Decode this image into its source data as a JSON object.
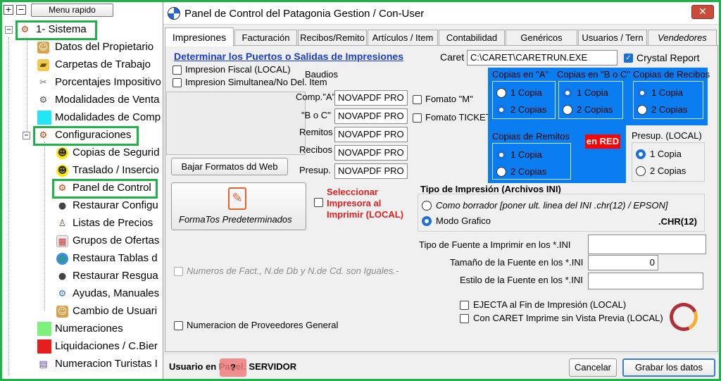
{
  "colors": {
    "highlight": "#1fb14a",
    "accent": "#0a7ef0",
    "red_badge": "#ff0000",
    "link": "#1a3ec8",
    "danger_text": "#e02020"
  },
  "tree": {
    "menu_rapido": "Menu rapido",
    "plus_btn": "+",
    "minus_btn": "−",
    "items": [
      {
        "label": "1- Sistema",
        "icon": "gear-icon"
      },
      {
        "label": "Datos del Propietario",
        "icon": "person-icon"
      },
      {
        "label": "Carpetas de Trabajo",
        "icon": "folder-icon"
      },
      {
        "label": "Porcentajes Impositivo",
        "icon": "tools-icon"
      },
      {
        "label": "Modalidades de Venta",
        "icon": "gear-icon"
      },
      {
        "label": "Modalidades de Comp",
        "icon": "cyan-square-icon"
      },
      {
        "label": "Configuraciones",
        "icon": "gear-icon"
      },
      {
        "label": "Copias de Segurid",
        "icon": "smiley-icon"
      },
      {
        "label": "Traslado / Insercio",
        "icon": "smiley-icon"
      },
      {
        "label": "Panel de Control",
        "icon": "gear-icon"
      },
      {
        "label": "Restaurar Configu",
        "icon": "traffic-light-icon"
      },
      {
        "label": "Listas de Precios",
        "icon": "person-icon"
      },
      {
        "label": "Grupos de Ofertas",
        "icon": "calendar-icon"
      },
      {
        "label": "Restaura Tablas d",
        "icon": "globe-icon"
      },
      {
        "label": "Restaurar Resgua",
        "icon": "traffic-light-icon"
      },
      {
        "label": "Ayudas, Manuales",
        "icon": "gear-icon"
      },
      {
        "label": "Cambio de Usuari",
        "icon": "person-icon"
      },
      {
        "label": "Numeraciones",
        "icon": "green-square-icon"
      },
      {
        "label": "Liquidaciones / C.Bier",
        "icon": "red-square-icon"
      },
      {
        "label": "Numeracion Turistas I",
        "icon": "book-icon"
      }
    ]
  },
  "window": {
    "title": "Panel de Control del Patagonia Gestion / Con-User",
    "close": "✕",
    "tabs": [
      "Impresiones",
      "Facturación",
      "Recibos/Remito",
      "Artículos / Item",
      "Contabilidad",
      "Genéricos",
      "Usuarios / Tern",
      "Vendedores"
    ]
  },
  "impresiones": {
    "determinar_link": "Determinar los Puertos o Salidas de Impresiones",
    "caret_label": "Caret",
    "caret_path": "C:\\CARET\\CARETRUN.EXE",
    "crystal_report": "Crystal Report",
    "impresion_fiscal": "Impresion  Fiscal (LOCAL)",
    "impresion_simultanea": "Impresion Simultanea/No Del. Item",
    "baudios": "Baudios",
    "printer_labels": [
      "Comp.\"A\"",
      "\"B o C\"",
      "Remitos",
      "Recibos",
      "Presup."
    ],
    "printer_values": [
      "NOVAPDF PRO",
      "NOVAPDF PRO",
      "NOVAPDF PRO",
      "NOVAPDF PRO",
      "NOVAPDF PRO"
    ],
    "fomato_m": "Fomato \"M\"",
    "fomato_ticket": "Fomato TICKET",
    "bajar_formatos": "Bajar Formatos dd Web",
    "formatos_predeterminados": "FormaTos Predeterminados",
    "seleccionar_impresora": "Seleccionar Impresora al Imprimir (LOCAL)",
    "copias_a": {
      "title": "Copias en \"A\"",
      "opt1": "1 Copia",
      "opt2": "2 Copias"
    },
    "copias_boc": {
      "title": "Copias en \"B o C\"",
      "opt1": "1 Copia",
      "opt2": "2 Copias"
    },
    "copias_recibos": {
      "title": "Copias de Recibos",
      "opt1": "1 Copia",
      "opt2": "2 Copias"
    },
    "copias_remitos": {
      "title": "Copias de Remitos",
      "opt1": "1 Copia",
      "opt2": "2 Copias"
    },
    "en_red": "en RED",
    "presup_local": {
      "title": "Presup. (LOCAL)",
      "opt1": "1 Copia",
      "opt2": "2 Copias"
    },
    "tipo_impresion_title": "Tipo de Impresión (Archivos INI)",
    "como_borrador": "Como borrador [poner ult. linea del INI .chr(12) / EPSON]",
    "modo_grafico": "Modo Grafico",
    "chr12": ".CHR(12)",
    "tipo_fuente_label": "Tipo de Fuente a Imprimir en los *.INI",
    "tipo_fuente_value": "",
    "tamano_fuente_label": "Tamaño de la Fuente en los *.INI",
    "tamano_fuente_value": "0",
    "estilo_fuente_label": "Estilo de la Fuente en los *.INI",
    "estilo_fuente_value": "",
    "numeros_fact": "Numeros de Fact., N.de Db y N.de Cd. son Iguales.-",
    "ejecta": "EJECTA al Fin de Impresión (LOCAL)",
    "con_caret": "Con CARET Imprime sin Vista Previa (LOCAL)",
    "numeracion_proveedores": "Numeracion de Proveedores General"
  },
  "status": {
    "usuario_label": "Usuario en Panel: SERVIDOR",
    "help_badge": "?",
    "cancelar": "Cancelar",
    "grabar": "Grabar los datos"
  }
}
